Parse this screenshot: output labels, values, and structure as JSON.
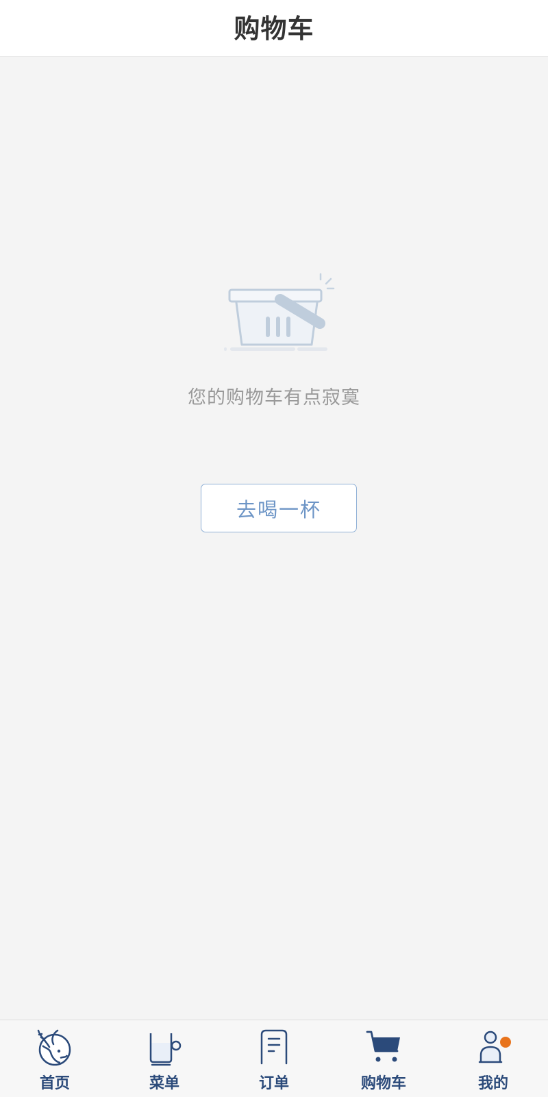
{
  "header": {
    "title": "购物车"
  },
  "empty_state": {
    "message": "您的购物车有点寂寞",
    "action_label": "去喝一杯",
    "illustration": "shopping-basket-icon"
  },
  "tabbar": {
    "active_index": 3,
    "items": [
      {
        "label": "首页",
        "icon": "deer-logo-icon"
      },
      {
        "label": "菜单",
        "icon": "cup-icon"
      },
      {
        "label": "订单",
        "icon": "receipt-icon"
      },
      {
        "label": "购物车",
        "icon": "cart-icon"
      },
      {
        "label": "我的",
        "icon": "user-icon",
        "notification_dot": true
      }
    ]
  },
  "colors": {
    "brand_navy": "#2b4a7a",
    "button_blue": "#6d95c6",
    "notification_orange": "#e8731c",
    "background": "#f4f4f4"
  }
}
